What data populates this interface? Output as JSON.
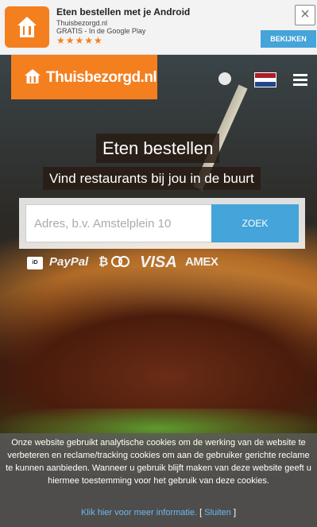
{
  "banner": {
    "title": "Eten bestellen met je Android",
    "developer": "Thuisbezorgd.nl",
    "price_store": "GRATIS - In de Google Play",
    "stars": "★★★★★",
    "close_icon": "×",
    "open_label": "BEKIJKEN"
  },
  "header": {
    "logo_text": "Thuisbezorgd.nl",
    "language_flag": "nl-flag",
    "flag_colors": [
      "#ae1c28",
      "#ffffff",
      "#21468b"
    ],
    "accent_color": "#f47f1f"
  },
  "hero": {
    "headline": "Eten bestellen",
    "subheadline": "Vind restaurants bij jou in de buurt"
  },
  "search": {
    "placeholder": "Adres, b.v. Amstelplein 10",
    "button_label": "ZOEK",
    "button_color": "#45a4d9"
  },
  "payments": {
    "ideal": "iD",
    "paypal": "PayPal",
    "bitcoin": "₿",
    "visa": "VISA",
    "amex": "AMEX"
  },
  "cookie": {
    "text": "Onze website gebruikt analytische cookies om de werking van de website te verbeteren en reclame/tracking cookies om aan de gebruiker gerichte reclame te kunnen aanbieden. Wanneer u gebruik blijft maken van deze website geeft u hiermee toestemming voor het gebruik van deze cookies.",
    "more_info_link": "Klik hier voor meer informatie.",
    "bracket_open": "[",
    "close_link": "Sluiten",
    "bracket_close": "]"
  }
}
